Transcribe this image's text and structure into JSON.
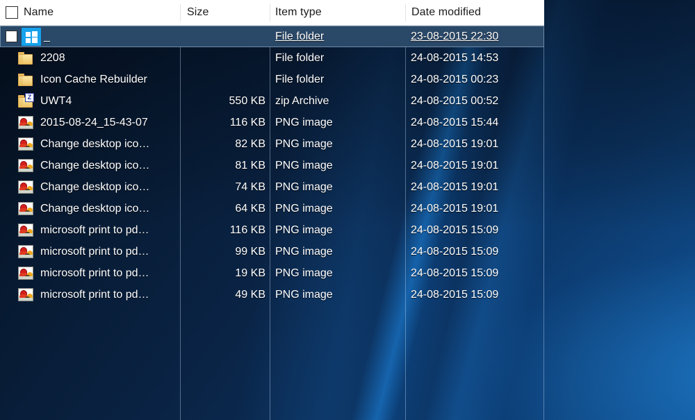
{
  "columns": [
    {
      "key": "name",
      "label": "Name"
    },
    {
      "key": "size",
      "label": "Size"
    },
    {
      "key": "type",
      "label": "Item type"
    },
    {
      "key": "date",
      "label": "Date modified"
    }
  ],
  "header": {
    "select_all_checkbox": "select-all-checkbox",
    "name_label": "Name",
    "size_label": "Size",
    "type_label": "Item type",
    "date_label": "Date modified"
  },
  "rows": [
    {
      "icon": "windows-logo-icon",
      "name": "_",
      "size": "",
      "type": "File folder",
      "date": "23-08-2015 22:30",
      "selected": true,
      "checkbox": true
    },
    {
      "icon": "folder-icon",
      "name": "2208",
      "size": "",
      "type": "File folder",
      "date": "24-08-2015 14:53",
      "selected": false,
      "checkbox": false
    },
    {
      "icon": "folder-icon",
      "name": "Icon Cache Rebuilder",
      "size": "",
      "type": "File folder",
      "date": "24-08-2015 00:23",
      "selected": false,
      "checkbox": false
    },
    {
      "icon": "zip-folder-icon",
      "name": "UWT4",
      "size": "550 KB",
      "type": "zip Archive",
      "date": "24-08-2015 00:52",
      "selected": false,
      "checkbox": false
    },
    {
      "icon": "png-image-icon",
      "name": "2015-08-24_15-43-07",
      "size": "116 KB",
      "type": "PNG image",
      "date": "24-08-2015 15:44",
      "selected": false,
      "checkbox": false
    },
    {
      "icon": "png-image-icon",
      "name": "Change desktop ico…",
      "size": "82 KB",
      "type": "PNG image",
      "date": "24-08-2015 19:01",
      "selected": false,
      "checkbox": false
    },
    {
      "icon": "png-image-icon",
      "name": "Change desktop ico…",
      "size": "81 KB",
      "type": "PNG image",
      "date": "24-08-2015 19:01",
      "selected": false,
      "checkbox": false
    },
    {
      "icon": "png-image-icon",
      "name": "Change desktop ico…",
      "size": "74 KB",
      "type": "PNG image",
      "date": "24-08-2015 19:01",
      "selected": false,
      "checkbox": false
    },
    {
      "icon": "png-image-icon",
      "name": "Change desktop ico…",
      "size": "64 KB",
      "type": "PNG image",
      "date": "24-08-2015 19:01",
      "selected": false,
      "checkbox": false
    },
    {
      "icon": "png-image-icon",
      "name": "microsoft print to pd…",
      "size": "116 KB",
      "type": "PNG image",
      "date": "24-08-2015 15:09",
      "selected": false,
      "checkbox": false
    },
    {
      "icon": "png-image-icon",
      "name": "microsoft print to pd…",
      "size": "99 KB",
      "type": "PNG image",
      "date": "24-08-2015 15:09",
      "selected": false,
      "checkbox": false
    },
    {
      "icon": "png-image-icon",
      "name": "microsoft print to pd…",
      "size": "19 KB",
      "type": "PNG image",
      "date": "24-08-2015 15:09",
      "selected": false,
      "checkbox": false
    },
    {
      "icon": "png-image-icon",
      "name": "microsoft print to pd…",
      "size": "49 KB",
      "type": "PNG image",
      "date": "24-08-2015 15:09",
      "selected": false,
      "checkbox": false
    }
  ],
  "colors": {
    "header_background": "#ffffff",
    "header_text": "#1a1a1a",
    "row_text": "#ffffff",
    "selection_fill": "#2a4868",
    "selection_border": "#6d8aa8",
    "grid_line": "#bed7f0",
    "folder_icon": "#f6d98b",
    "windows_logo_tile": "#17a2ec",
    "zip_badge": "#1a30a0"
  },
  "zip_badge_letter": "Z"
}
